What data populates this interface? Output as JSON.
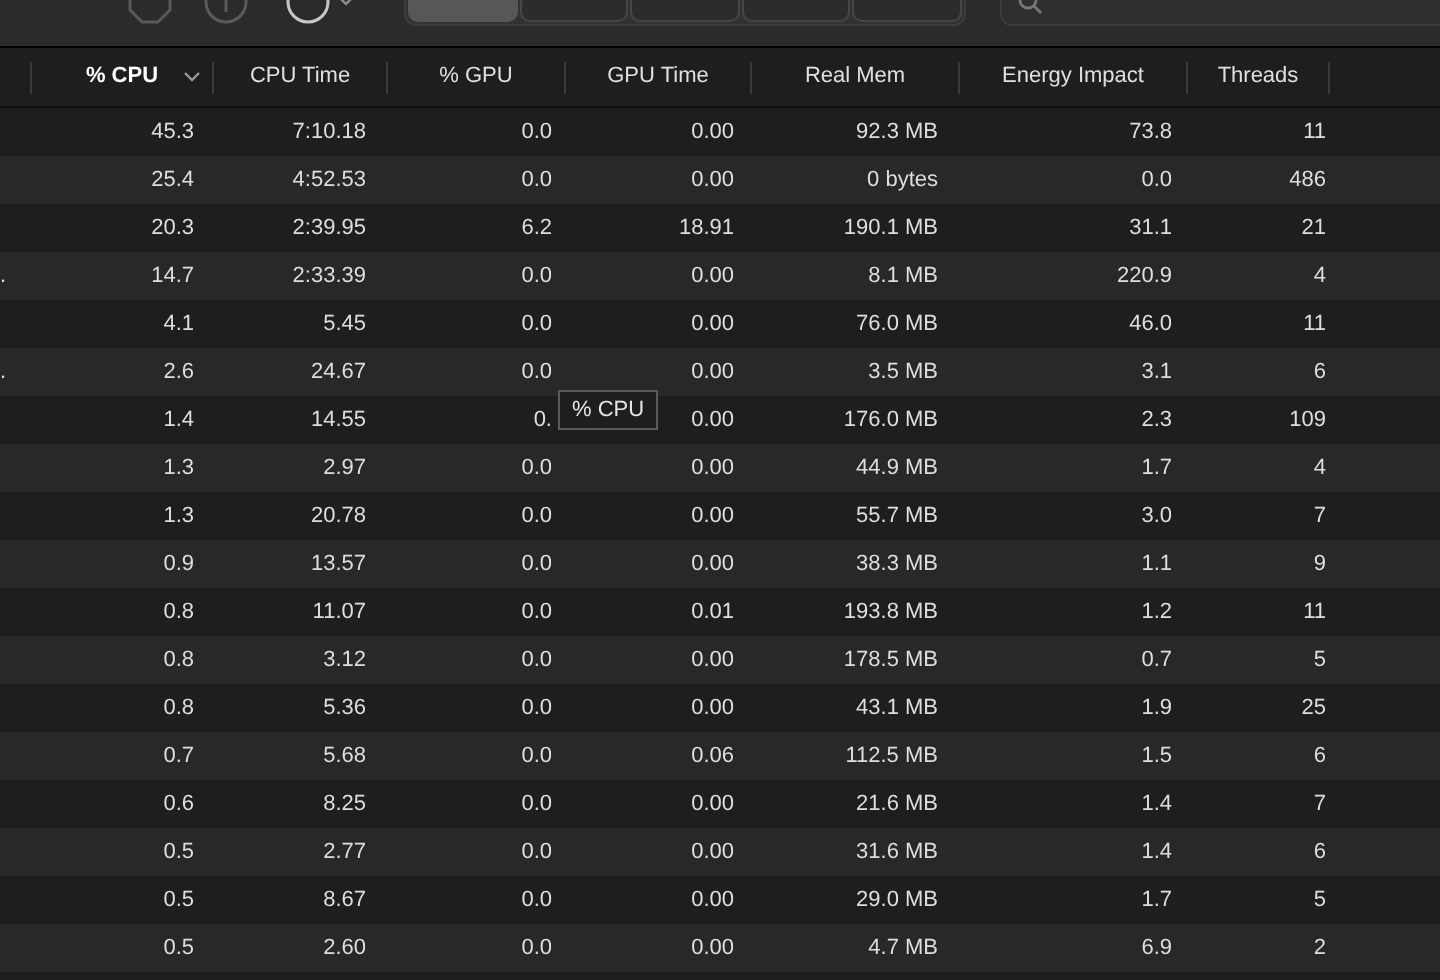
{
  "toolbar": {
    "tabs": [
      {
        "selected": true
      },
      {
        "selected": false
      },
      {
        "selected": false
      },
      {
        "selected": false
      },
      {
        "selected": false
      }
    ]
  },
  "table": {
    "columns": [
      {
        "label": "% CPU",
        "sorted": true
      },
      {
        "label": "CPU Time",
        "sorted": false
      },
      {
        "label": "% GPU",
        "sorted": false
      },
      {
        "label": "GPU Time",
        "sorted": false
      },
      {
        "label": "Real Mem",
        "sorted": false
      },
      {
        "label": "Energy Impact",
        "sorted": false
      },
      {
        "label": "Threads",
        "sorted": false
      }
    ],
    "rows": [
      {
        "cells": [
          "45.3",
          "7:10.18",
          "0.0",
          "0.00",
          "92.3 MB",
          "73.8",
          "11"
        ]
      },
      {
        "cells": [
          "25.4",
          "4:52.53",
          "0.0",
          "0.00",
          "0 bytes",
          "0.0",
          "486"
        ]
      },
      {
        "cells": [
          "20.3",
          "2:39.95",
          "6.2",
          "18.91",
          "190.1 MB",
          "31.1",
          "21"
        ]
      },
      {
        "name": ".",
        "cells": [
          "14.7",
          "2:33.39",
          "0.0",
          "0.00",
          "8.1 MB",
          "220.9",
          "4"
        ]
      },
      {
        "cells": [
          "4.1",
          "5.45",
          "0.0",
          "0.00",
          "76.0 MB",
          "46.0",
          "11"
        ]
      },
      {
        "name": ".",
        "cells": [
          "2.6",
          "24.67",
          "0.0",
          "0.00",
          "3.5 MB",
          "3.1",
          "6"
        ]
      },
      {
        "cells": [
          "1.4",
          "14.55",
          "0.",
          "0.00",
          "176.0 MB",
          "2.3",
          "109"
        ]
      },
      {
        "cells": [
          "1.3",
          "2.97",
          "0.0",
          "0.00",
          "44.9 MB",
          "1.7",
          "4"
        ]
      },
      {
        "cells": [
          "1.3",
          "20.78",
          "0.0",
          "0.00",
          "55.7 MB",
          "3.0",
          "7"
        ]
      },
      {
        "cells": [
          "0.9",
          "13.57",
          "0.0",
          "0.00",
          "38.3 MB",
          "1.1",
          "9"
        ]
      },
      {
        "cells": [
          "0.8",
          "11.07",
          "0.0",
          "0.01",
          "193.8 MB",
          "1.2",
          "11"
        ]
      },
      {
        "cells": [
          "0.8",
          "3.12",
          "0.0",
          "0.00",
          "178.5 MB",
          "0.7",
          "5"
        ]
      },
      {
        "cells": [
          "0.8",
          "5.36",
          "0.0",
          "0.00",
          "43.1 MB",
          "1.9",
          "25"
        ]
      },
      {
        "cells": [
          "0.7",
          "5.68",
          "0.0",
          "0.06",
          "112.5 MB",
          "1.5",
          "6"
        ]
      },
      {
        "cells": [
          "0.6",
          "8.25",
          "0.0",
          "0.00",
          "21.6 MB",
          "1.4",
          "7"
        ]
      },
      {
        "cells": [
          "0.5",
          "2.77",
          "0.0",
          "0.00",
          "31.6 MB",
          "1.4",
          "6"
        ]
      },
      {
        "cells": [
          "0.5",
          "8.67",
          "0.0",
          "0.00",
          "29.0 MB",
          "1.7",
          "5"
        ]
      },
      {
        "cells": [
          "0.5",
          "2.60",
          "0.0",
          "0.00",
          "4.7 MB",
          "6.9",
          "2"
        ]
      }
    ]
  },
  "tooltip": {
    "text": "% CPU"
  }
}
